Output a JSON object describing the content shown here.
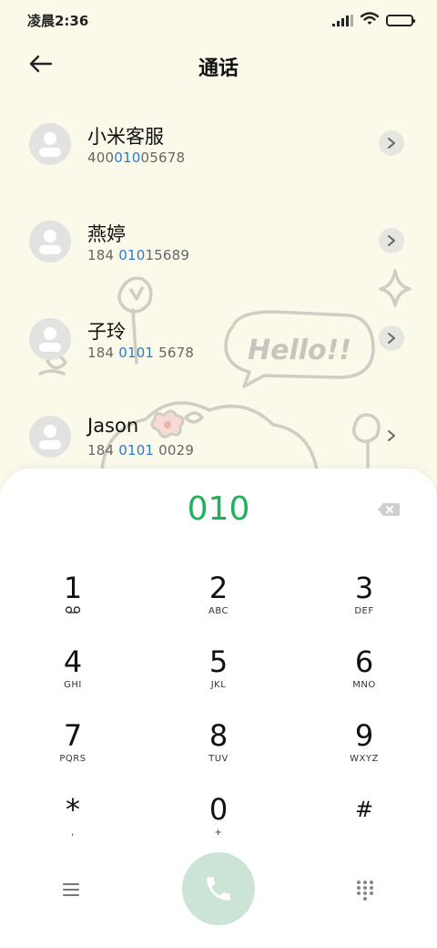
{
  "status": {
    "time": "凌晨2:36"
  },
  "header": {
    "title": "通话"
  },
  "contacts": [
    {
      "name": "小米客服",
      "number": {
        "pre": "400",
        "hl": "010",
        "post": "05678"
      }
    },
    {
      "name": "燕婷",
      "number": {
        "pre": "184 ",
        "hl": "010",
        "post": "15689"
      }
    },
    {
      "name": "子玲",
      "number": {
        "pre": "184 ",
        "hl": "0101",
        "post": " 5678"
      }
    },
    {
      "name": "Jason",
      "number": {
        "pre": "184 ",
        "hl": "0101",
        "post": " 0029"
      }
    }
  ],
  "decoration": {
    "bubble_text": "Hello!!"
  },
  "dialpad": {
    "input": "010",
    "keys": [
      {
        "digit": "1",
        "letters": ""
      },
      {
        "digit": "2",
        "letters": "ABC"
      },
      {
        "digit": "3",
        "letters": "DEF"
      },
      {
        "digit": "4",
        "letters": "GHI"
      },
      {
        "digit": "5",
        "letters": "JKL"
      },
      {
        "digit": "6",
        "letters": "MNO"
      },
      {
        "digit": "7",
        "letters": "PQRS"
      },
      {
        "digit": "8",
        "letters": "TUV"
      },
      {
        "digit": "9",
        "letters": "WXYZ"
      },
      {
        "digit": "*",
        "letters": ","
      },
      {
        "digit": "0",
        "letters": "+"
      },
      {
        "digit": "#",
        "letters": ""
      }
    ]
  },
  "colors": {
    "accent_green": "#1fb25a",
    "number_highlight": "#2a7bd4",
    "call_button": "#cbe4d5",
    "background": "#fbf9ea"
  },
  "icons": {
    "back": "arrow-left-icon",
    "chevron": "chevron-right-icon",
    "backspace": "backspace-icon",
    "menu": "menu-icon",
    "call": "phone-icon",
    "dialpad": "dialpad-grid-icon",
    "voicemail": "voicemail-icon"
  }
}
